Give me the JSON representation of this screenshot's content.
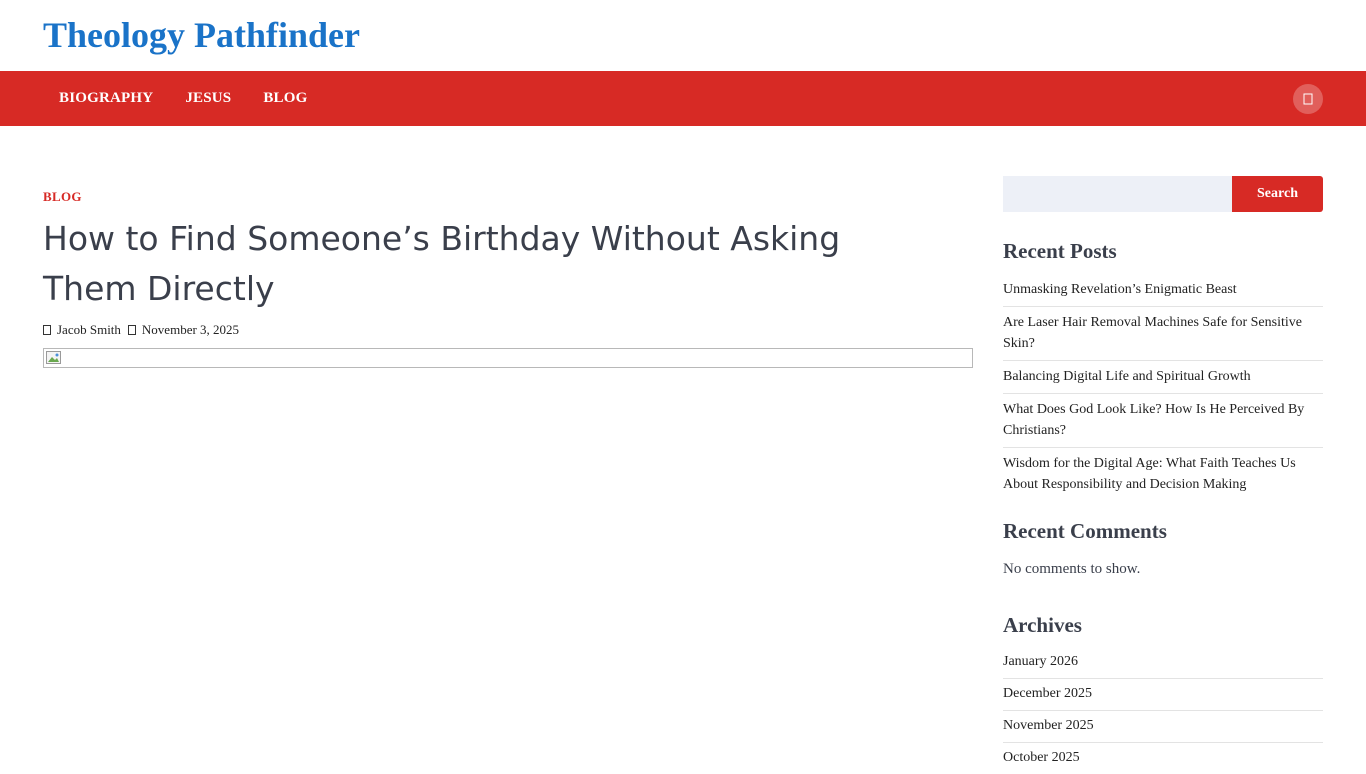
{
  "site": {
    "title": "Theology Pathfinder"
  },
  "nav": {
    "items": [
      {
        "label": "BIOGRAPHY"
      },
      {
        "label": "JESUS"
      },
      {
        "label": "BLOG"
      }
    ],
    "search_icon": "search-icon"
  },
  "post": {
    "category": "BLOG",
    "title": "How to Find Someone’s Birthday Without Asking Them Directly",
    "author": "Jacob Smith",
    "date": "November 3, 2025",
    "author_icon": "user-icon",
    "date_icon": "calendar-icon"
  },
  "sidebar": {
    "search": {
      "placeholder": "",
      "button_label": "Search"
    },
    "recent_posts": {
      "title": "Recent Posts",
      "items": [
        "Unmasking Revelation’s Enigmatic Beast",
        "Are Laser Hair Removal Machines Safe for Sensitive Skin?",
        "Balancing Digital Life and Spiritual Growth",
        "What Does God Look Like? How Is He Perceived By Christians?",
        "Wisdom for the Digital Age: What Faith Teaches Us About Responsibility and Decision Making"
      ]
    },
    "recent_comments": {
      "title": "Recent Comments",
      "empty_text": "No comments to show."
    },
    "archives": {
      "title": "Archives",
      "items": [
        "January 2026",
        "December 2025",
        "November 2025",
        "October 2025"
      ]
    }
  },
  "colors": {
    "brand_blue": "#1a73c8",
    "accent_red": "#d72a25",
    "search_bg": "#edf0f7"
  }
}
